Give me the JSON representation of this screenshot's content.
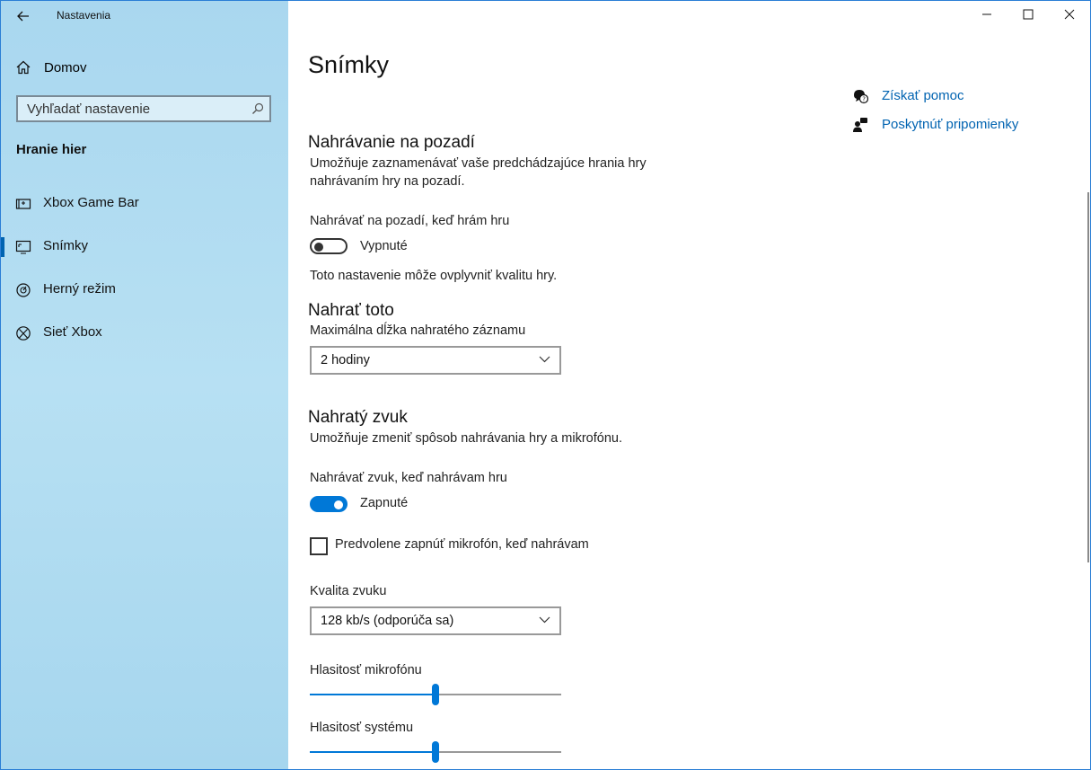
{
  "window": {
    "title": "Nastavenia",
    "controls": {
      "minimize": "minimize-icon",
      "maximize": "maximize-icon",
      "close": "close-icon"
    }
  },
  "sidebar": {
    "home_label": "Domov",
    "search_placeholder": "Vyhľadať nastavenie",
    "section_title": "Hranie hier",
    "items": [
      {
        "label": "Xbox Game Bar",
        "icon": "game-bar-icon",
        "active": false
      },
      {
        "label": "Snímky",
        "icon": "captures-icon",
        "active": true
      },
      {
        "label": "Herný režim",
        "icon": "game-mode-icon",
        "active": false
      },
      {
        "label": "Sieť Xbox",
        "icon": "xbox-icon",
        "active": false
      }
    ]
  },
  "main": {
    "title": "Snímky",
    "background_recording": {
      "heading": "Nahrávanie na pozadí",
      "desc_line1": "Umožňuje zaznamenávať vaše predchádzajúce hrania hry",
      "desc_line2": "nahrávaním hry na pozadí.",
      "toggle_caption": "Nahrávať na pozadí, keď hrám hru",
      "toggle_state": "Vypnuté",
      "toggle_on": false,
      "note": "Toto nastavenie môže ovplyvniť kvalitu hry."
    },
    "record_this": {
      "heading": "Nahrať toto",
      "caption": "Maximálna dĺžka nahratého záznamu",
      "selected": "2 hodiny"
    },
    "recorded_audio": {
      "heading": "Nahratý zvuk",
      "desc": "Umožňuje zmeniť spôsob nahrávania hry a mikrofónu.",
      "toggle_caption": "Nahrávať zvuk, keď nahrávam hru",
      "toggle_state": "Zapnuté",
      "toggle_on": true,
      "mic_checkbox_label": "Predvolene zapnúť mikrofón, keď nahrávam",
      "mic_checkbox_checked": false,
      "quality_caption": "Kvalita zvuku",
      "quality_selected": "128 kb/s (odporúča sa)",
      "mic_volume_caption": "Hlasitosť mikrofónu",
      "mic_volume": 0.5,
      "system_volume_caption": "Hlasitosť systému",
      "system_volume": 0.5
    },
    "help": {
      "get_help": "Získať pomoc",
      "feedback": "Poskytnúť pripomienky"
    }
  },
  "colors": {
    "accent": "#0078d7",
    "link": "#0063b1",
    "sidebar": "#b0dcf1"
  }
}
